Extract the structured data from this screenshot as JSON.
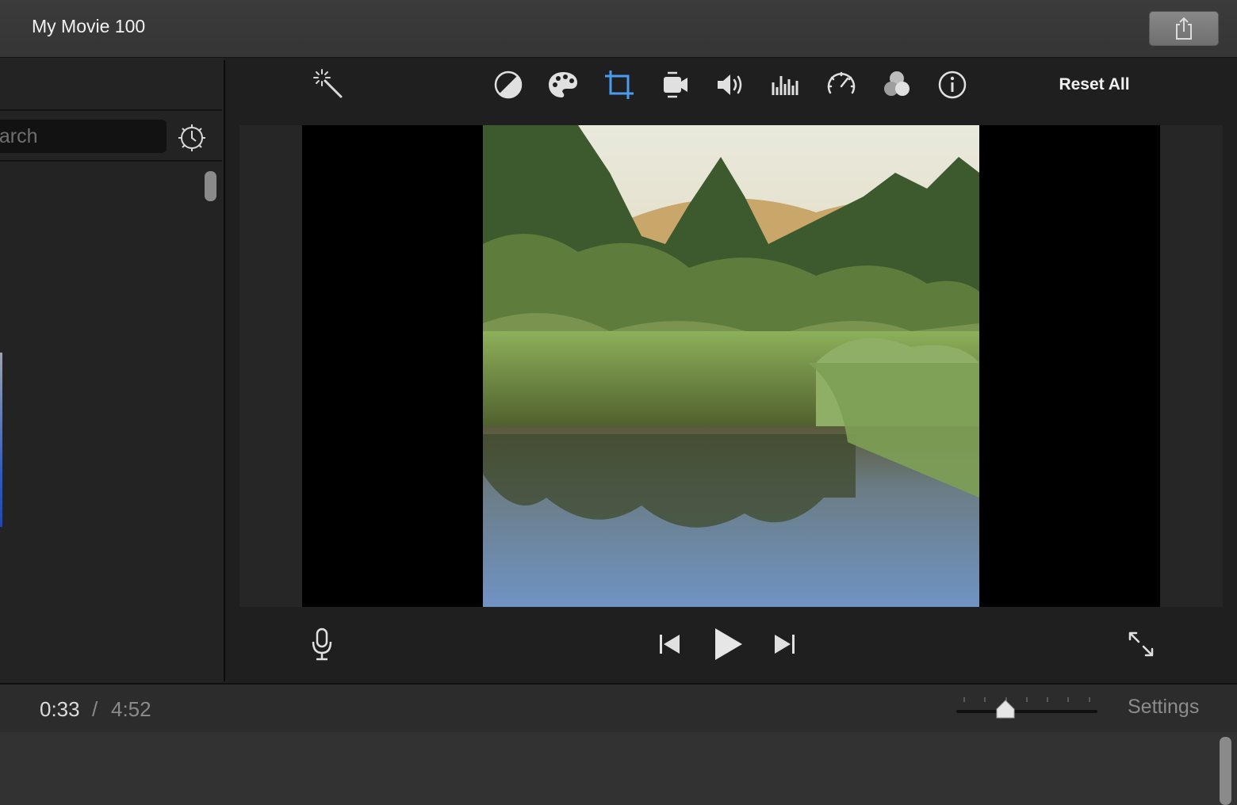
{
  "window": {
    "title": "My Movie 100"
  },
  "sidebar": {
    "search_text": "earch",
    "settings_icon": "gear-icon"
  },
  "toolbar": {
    "tools": [
      {
        "name": "auto-enhance",
        "icon": "magic-wand-icon"
      },
      {
        "name": "color-balance",
        "icon": "color-balance-icon"
      },
      {
        "name": "color-correction",
        "icon": "palette-icon"
      },
      {
        "name": "cropping",
        "icon": "crop-icon",
        "active": true
      },
      {
        "name": "stabilization",
        "icon": "video-camera-icon"
      },
      {
        "name": "volume",
        "icon": "speaker-icon"
      },
      {
        "name": "noise-reduction",
        "icon": "equalizer-icon"
      },
      {
        "name": "speed",
        "icon": "speedometer-icon"
      },
      {
        "name": "clip-filter",
        "icon": "filter-circles-icon"
      },
      {
        "name": "clip-info",
        "icon": "info-icon"
      }
    ],
    "reset_all_label": "Reset All",
    "accent_color": "#4a9cf0"
  },
  "controls": {
    "voiceover_icon": "microphone-icon",
    "previous_icon": "skip-back-icon",
    "play_icon": "play-icon",
    "next_icon": "skip-forward-icon",
    "fullscreen_icon": "expand-icon"
  },
  "timeline_bar": {
    "current_time": "0:33",
    "separator": "/",
    "total_duration": "4:52",
    "settings_label": "Settings",
    "zoom_level": 0.35
  }
}
